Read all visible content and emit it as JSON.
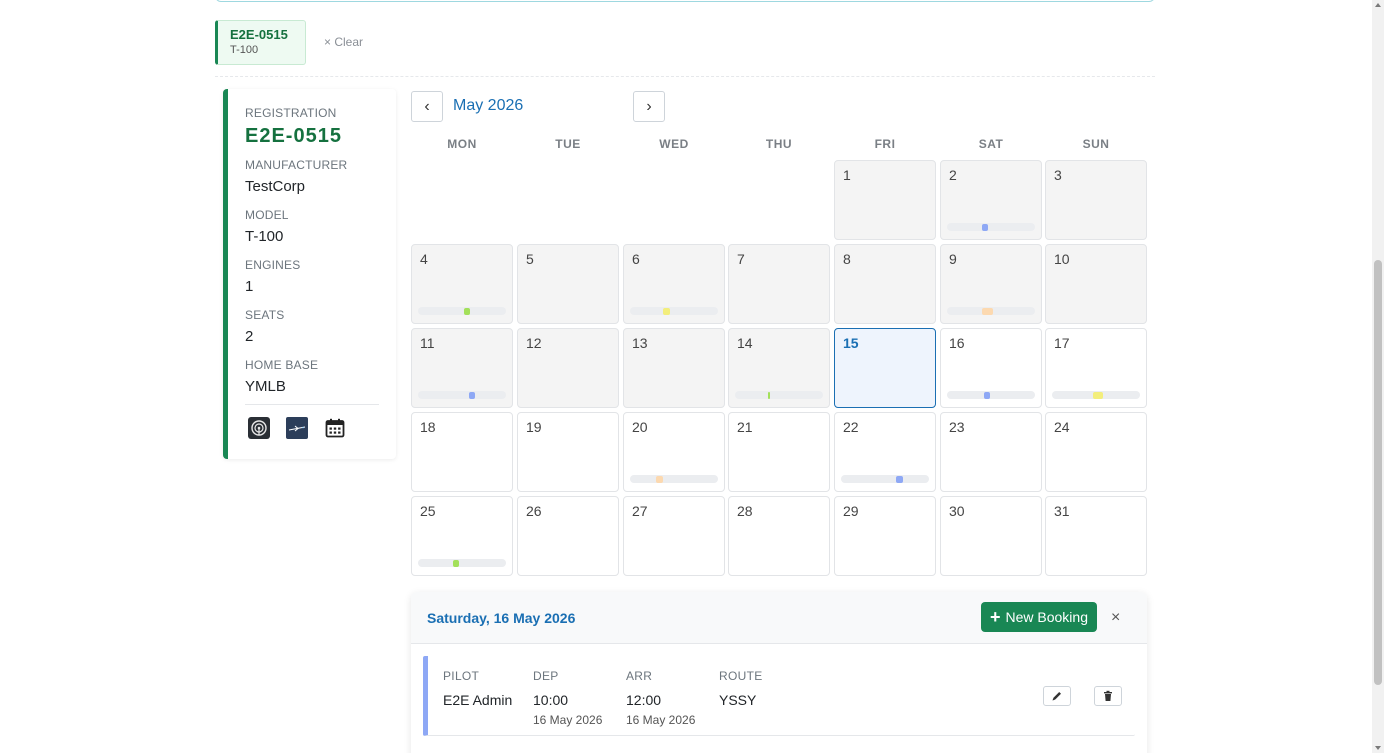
{
  "selection_chip": {
    "registration": "E2E-0515",
    "model": "T-100",
    "clear_label": "× Clear"
  },
  "aircraft": {
    "fields": [
      {
        "label": "REGISTRATION",
        "value": "E2E-0515"
      },
      {
        "label": "MANUFACTURER",
        "value": "TestCorp"
      },
      {
        "label": "MODEL",
        "value": "T-100"
      },
      {
        "label": "ENGINES",
        "value": "1"
      },
      {
        "label": "SEATS",
        "value": "2"
      },
      {
        "label": "HOME BASE",
        "value": "YMLB"
      }
    ],
    "icons": [
      "radar-icon",
      "flight-icon",
      "calendar-icon"
    ]
  },
  "calendar": {
    "month_label": "May 2026",
    "prev_label": "‹",
    "next_label": "›",
    "weekdays": [
      "MON",
      "TUE",
      "WED",
      "THU",
      "FRI",
      "SAT",
      "SUN"
    ],
    "first_weekday_index": 4,
    "days_in_month": 31,
    "today": 15,
    "colors": {
      "blue": "#8ea8f5",
      "green": "#a3e05a",
      "yellow": "#f3ee7c",
      "orange": "#fcd9b0"
    },
    "bookings": [
      {
        "day": 2,
        "color": "blue",
        "start": 0.4,
        "end": 0.47
      },
      {
        "day": 4,
        "color": "green",
        "start": 0.52,
        "end": 0.59
      },
      {
        "day": 6,
        "color": "yellow",
        "start": 0.38,
        "end": 0.45
      },
      {
        "day": 9,
        "color": "orange",
        "start": 0.4,
        "end": 0.52
      },
      {
        "day": 11,
        "color": "blue",
        "start": 0.58,
        "end": 0.65
      },
      {
        "day": 14,
        "color": "green",
        "start": 0.37,
        "end": 0.4
      },
      {
        "day": 16,
        "color": "blue",
        "start": 0.42,
        "end": 0.49
      },
      {
        "day": 17,
        "color": "yellow",
        "start": 0.47,
        "end": 0.58
      },
      {
        "day": 20,
        "color": "orange",
        "start": 0.3,
        "end": 0.37
      },
      {
        "day": 22,
        "color": "blue",
        "start": 0.63,
        "end": 0.7
      },
      {
        "day": 25,
        "color": "green",
        "start": 0.4,
        "end": 0.47
      }
    ]
  },
  "detail": {
    "title": "Saturday, 16 May 2026",
    "new_booking_label": "New Booking",
    "close_label": "×",
    "booking": {
      "pilot_label": "PILOT",
      "pilot": "E2E Admin",
      "dep_label": "DEP",
      "dep_time": "10:00",
      "dep_date": "16 May 2026",
      "arr_label": "ARR",
      "arr_time": "12:00",
      "arr_date": "16 May 2026",
      "route_label": "ROUTE",
      "route": "YSSY"
    }
  }
}
